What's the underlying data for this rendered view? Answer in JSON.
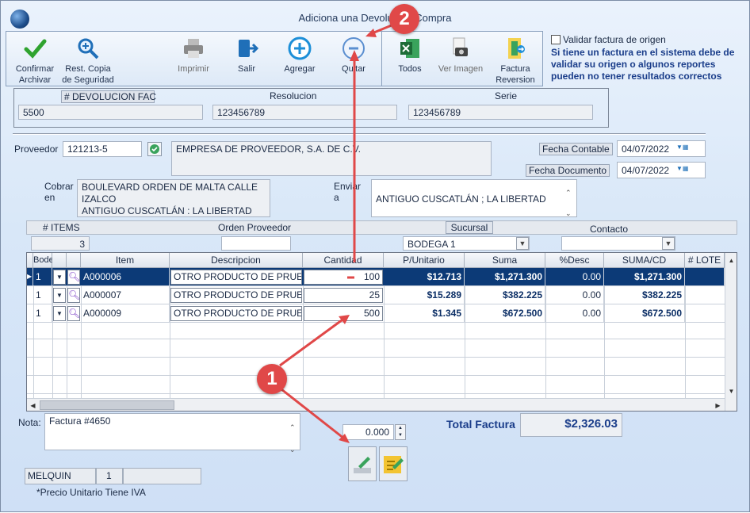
{
  "window": {
    "title": "Adiciona una Devolución Compra"
  },
  "toolbar": {
    "confirmar": "Confirmar\nArchivar",
    "rest_copia": "Rest. Copia\nde Seguridad",
    "imprimir": "Imprimir",
    "salir": "Salir",
    "agregar": "Agregar",
    "quitar": "Quitar",
    "todos": "Todos",
    "ver_imagen": "Ver Imagen",
    "factura_reversion": "Factura\nReversion"
  },
  "validation": {
    "checkbox_label": "Validar factura de origen",
    "warning": "Si tiene un factura en el sistema debe de validar su origen o algunos reportes pueden no tener resultados correctos"
  },
  "header": {
    "devolucion_label": "# DEVOLUCION FAC",
    "devolucion_value": "5500",
    "resolucion_label": "Resolucion",
    "resolucion_value": "123456789",
    "serie_label": "Serie",
    "serie_value": "123456789"
  },
  "proveedor": {
    "label": "Proveedor",
    "code": "121213-5",
    "name": "EMPRESA DE PROVEEDOR, S.A. DE C.V.",
    "fecha_contable_label": "Fecha Contable",
    "fecha_contable": "04/07/2022",
    "fecha_documento_label": "Fecha Documento",
    "fecha_documento": "04/07/2022",
    "cobrar_label": "Cobrar\nen",
    "cobrar_lines": [
      "BOULEVARD ORDEN DE MALTA CALLE",
      "IZALCO",
      "ANTIGUO CUSCATLÁN : LA LIBERTAD"
    ],
    "enviar_label": "Enviar\na",
    "enviar_value": "ANTIGUO CUSCATLÁN ; LA LIBERTAD"
  },
  "summary": {
    "items_label": "# ITEMS",
    "items_value": "3",
    "orden_label": "Orden Proveedor",
    "orden_value": "",
    "sucursal_label": "Sucursal",
    "sucursal_value": "BODEGA 1",
    "contacto_label": "Contacto",
    "contacto_value": ""
  },
  "grid": {
    "columns": [
      "Bodega",
      "",
      "Item",
      "Descripcion",
      "Cantidad",
      "P/Unitario",
      "Suma",
      "%Desc",
      "SUMA/CD",
      "# LOTE"
    ],
    "rows": [
      {
        "bodega": "1",
        "item": "A000006",
        "descripcion": "OTRO PRODUCTO DE PRUEBA",
        "cantidad": "100",
        "punitario": "$12.713",
        "suma": "$1,271.300",
        "desc": "0.00",
        "sumacd": "$1,271.300"
      },
      {
        "bodega": "1",
        "item": "A000007",
        "descripcion": "OTRO PRODUCTO DE PRUEBA",
        "cantidad": "25",
        "punitario": "$15.289",
        "suma": "$382.225",
        "desc": "0.00",
        "sumacd": "$382.225"
      },
      {
        "bodega": "1",
        "item": "A000009",
        "descripcion": "OTRO PRODUCTO DE PRUEBA",
        "cantidad": "500",
        "punitario": "$1.345",
        "suma": "$672.500",
        "desc": "0.00",
        "sumacd": "$672.500"
      }
    ]
  },
  "footer": {
    "nota_label": "Nota:",
    "nota_value": "Factura  #4650",
    "descuento_value": "0.000",
    "total_label": "Total Factura",
    "total_value": "$2,326.03",
    "user": "MELQUIN",
    "user_num": "1",
    "user_extra": "",
    "iva_note": "*Precio Unitario Tiene IVA"
  },
  "annotations": {
    "badge1": "1",
    "badge2": "2"
  },
  "colors": {
    "selected_row": "#0c3a77",
    "badge": "#e04848",
    "accent": "#1a3d8a"
  }
}
